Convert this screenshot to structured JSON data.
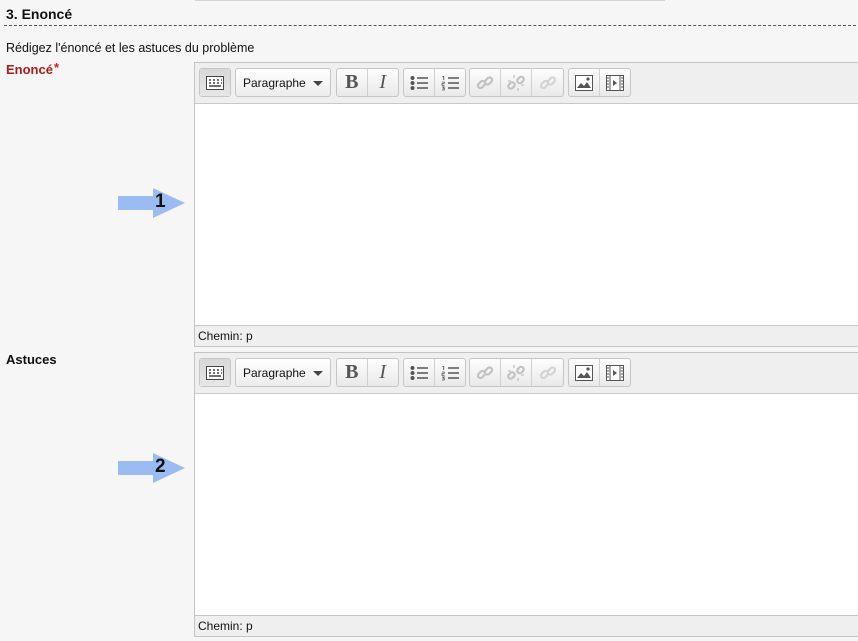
{
  "section": {
    "title": "3. Enoncé",
    "instructions": "Rédigez l'énoncé et les astuces du problème"
  },
  "fields": {
    "enonce": {
      "label": "Enoncé",
      "required_marker": "*"
    },
    "astuces": {
      "label": "Astuces"
    }
  },
  "editor": {
    "format_select": "Paragraphe",
    "path_text": "Chemin: p",
    "toolbar_icons": [
      "toolbar-toggle-icon",
      "bold-icon",
      "italic-icon",
      "bullet-list-icon",
      "numbered-list-icon",
      "link-icon",
      "unlink-icon",
      "anchor-icon",
      "image-icon",
      "media-icon"
    ]
  },
  "annotations": {
    "arrow_1_label": "1",
    "arrow_2_label": "2",
    "arrow_color": "#9bbcf2"
  },
  "colors": {
    "required_label": "#aa1d1d",
    "background": "#f6f6f6"
  }
}
